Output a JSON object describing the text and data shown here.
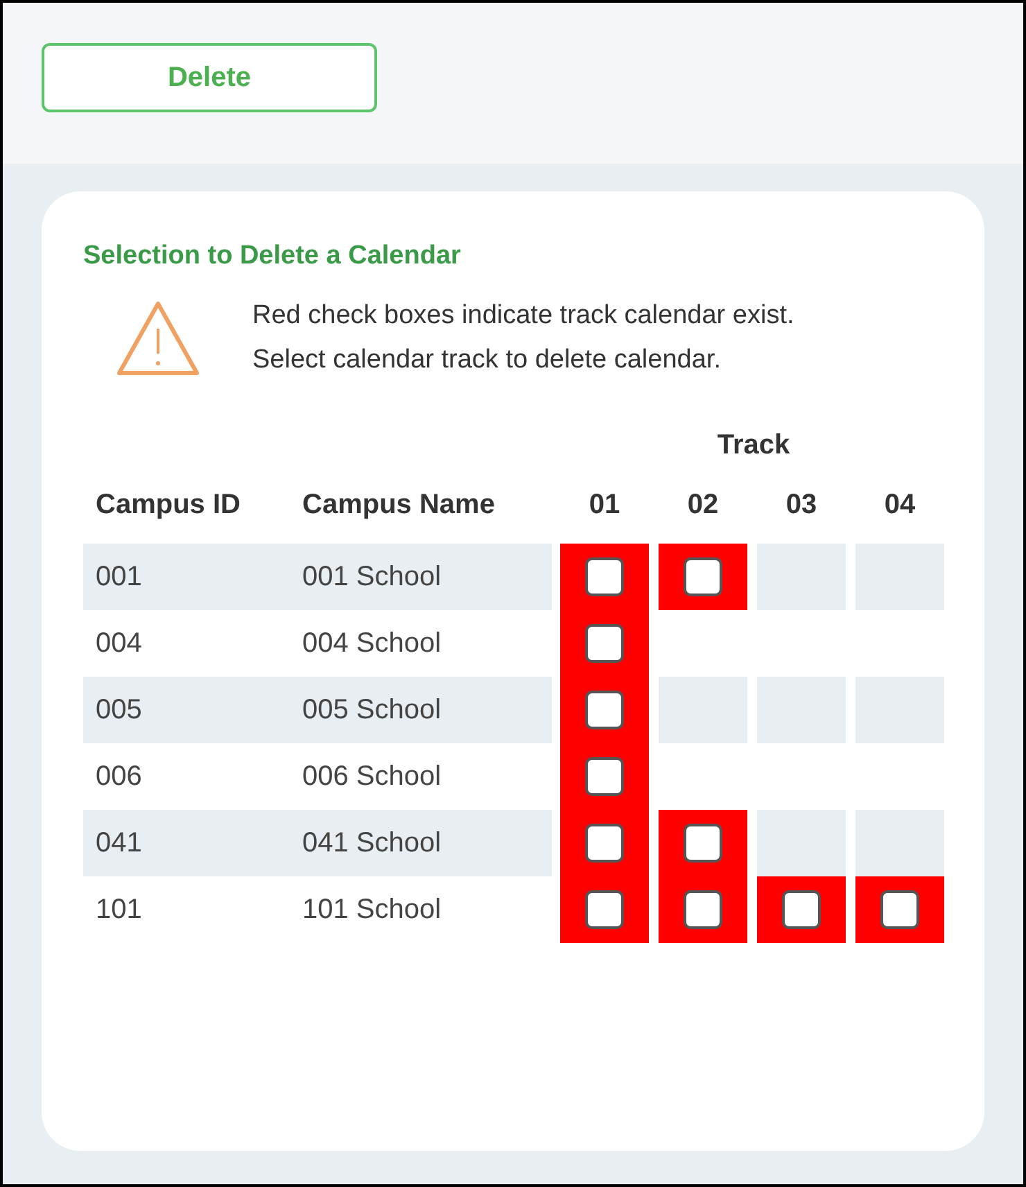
{
  "toolbar": {
    "delete_button": "Delete"
  },
  "panel": {
    "title": "Selection to Delete a Calendar",
    "notice_lines": [
      "Red check boxes indicate track calendar exist.",
      "Select calendar track to delete calendar."
    ]
  },
  "table": {
    "group_header": "Track",
    "columns": [
      "Campus ID",
      "Campus Name",
      "01",
      "02",
      "03",
      "04"
    ],
    "rows": [
      {
        "campus_id": "001",
        "campus_name": "001 School",
        "tracks": [
          {
            "exists": true,
            "checked": false
          },
          {
            "exists": true,
            "checked": false
          },
          {
            "exists": false
          },
          {
            "exists": false
          }
        ]
      },
      {
        "campus_id": "004",
        "campus_name": "004 School",
        "tracks": [
          {
            "exists": true,
            "checked": false
          },
          {
            "exists": false
          },
          {
            "exists": false
          },
          {
            "exists": false
          }
        ]
      },
      {
        "campus_id": "005",
        "campus_name": "005 School",
        "tracks": [
          {
            "exists": true,
            "checked": false
          },
          {
            "exists": false
          },
          {
            "exists": false
          },
          {
            "exists": false
          }
        ]
      },
      {
        "campus_id": "006",
        "campus_name": "006 School",
        "tracks": [
          {
            "exists": true,
            "checked": false
          },
          {
            "exists": false
          },
          {
            "exists": false
          },
          {
            "exists": false
          }
        ]
      },
      {
        "campus_id": "041",
        "campus_name": "041 School",
        "tracks": [
          {
            "exists": true,
            "checked": false
          },
          {
            "exists": true,
            "checked": false
          },
          {
            "exists": false
          },
          {
            "exists": false
          }
        ]
      },
      {
        "campus_id": "101",
        "campus_name": "101 School",
        "tracks": [
          {
            "exists": true,
            "checked": false
          },
          {
            "exists": true,
            "checked": false
          },
          {
            "exists": true,
            "checked": false
          },
          {
            "exists": true,
            "checked": false
          }
        ]
      }
    ]
  }
}
